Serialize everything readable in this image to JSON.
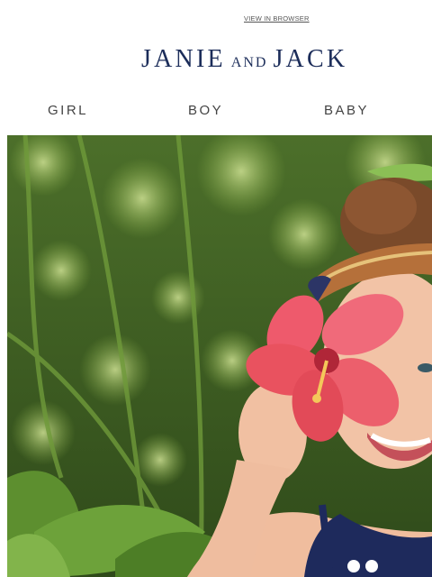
{
  "header": {
    "view_in_browser": "VIEW IN BROWSER",
    "brand": {
      "part1": "JANIE",
      "part2": "AND",
      "part3": "JACK"
    }
  },
  "nav": {
    "items": [
      {
        "label": "GIRL"
      },
      {
        "label": "BOY"
      },
      {
        "label": "BABY"
      }
    ]
  },
  "hero": {
    "image_subject": "girl-holding-pink-hibiscus-flower"
  },
  "colors": {
    "brand_navy": "#1c2d5a",
    "nav_text": "#444444",
    "link_text": "#555555",
    "flower_pink": "#ee5a6c"
  }
}
